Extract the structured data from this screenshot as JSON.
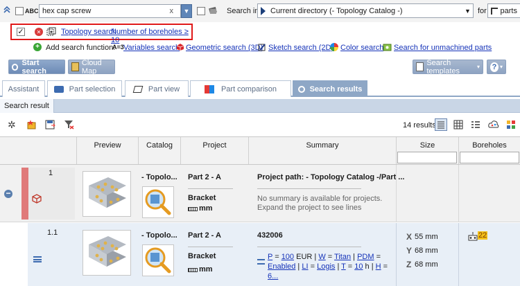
{
  "search_bar": {
    "abc_label": "ABC",
    "query_value": "hex cap screw",
    "clear_glyph": "x",
    "search_in_label": "Search in",
    "directory_value": "Current directory (- Topology Catalog -)",
    "for_label": "for",
    "for_value": "parts"
  },
  "criteria": {
    "topology_link": "Topology search",
    "boreholes_link": "Number of boreholes ≥ 10"
  },
  "add_function": {
    "label": "Add search function:",
    "variables_prefix": "A=3",
    "variables": "Variables search",
    "geometric": "Geometric search (3D)",
    "sketch": "Sketch search (2D)",
    "color": "Color search",
    "unmachined": "Search for unmachined parts"
  },
  "buttons": {
    "start_search": "Start search",
    "cloud_map": "Cloud Map",
    "search_templates": "Search templates",
    "help": "?"
  },
  "tabs": [
    {
      "label": "Assistant"
    },
    {
      "label": "Part selection"
    },
    {
      "label": "Part view"
    },
    {
      "label": "Part comparison"
    },
    {
      "label": "Search results"
    }
  ],
  "subtab": {
    "label": "Search result"
  },
  "results": {
    "count": "14 results"
  },
  "columns": {
    "preview": "Preview",
    "catalog": "Catalog",
    "project": "Project",
    "summary": "Summary",
    "size": "Size",
    "boreholes": "Boreholes"
  },
  "rows": [
    {
      "index": "1",
      "catalog": "- Topolo...",
      "project": "Part 2 - A",
      "type": "Bracket",
      "unit": "mm",
      "summary_title": "Project path: - Topology Catalog -/Part ...",
      "summary_note_1": "No summary is available for projects.",
      "summary_note_2": "Expand the project to see lines"
    },
    {
      "index": "1.1",
      "catalog": "- Topolo...",
      "project": "Part 2 - A",
      "type": "Bracket",
      "unit": "mm",
      "summary_title": "432006",
      "attrs_line1": [
        {
          "k": "P",
          "v": "100",
          "suffix": " EUR"
        },
        {
          "k": "W",
          "v": "Titan"
        },
        {
          "k": "PDM",
          "v": ""
        }
      ],
      "attrs_line2_start": "Enabled",
      "attrs_line2": [
        {
          "k": "LI",
          "v": "Logis"
        },
        {
          "k": "T",
          "v": "10",
          "suffix": " h"
        },
        {
          "k": "H",
          "v": "6..."
        }
      ],
      "size_x": "55 mm",
      "size_y": "68 mm",
      "size_z": "68 mm",
      "boreholes": "22"
    }
  ],
  "colors": {
    "accent_blue": "#8ea7c6",
    "link": "#1432b8",
    "highlight_red": "#e01818",
    "row_selected_bar": "#e07a7a",
    "borehole_badge": "#f3c01a"
  }
}
